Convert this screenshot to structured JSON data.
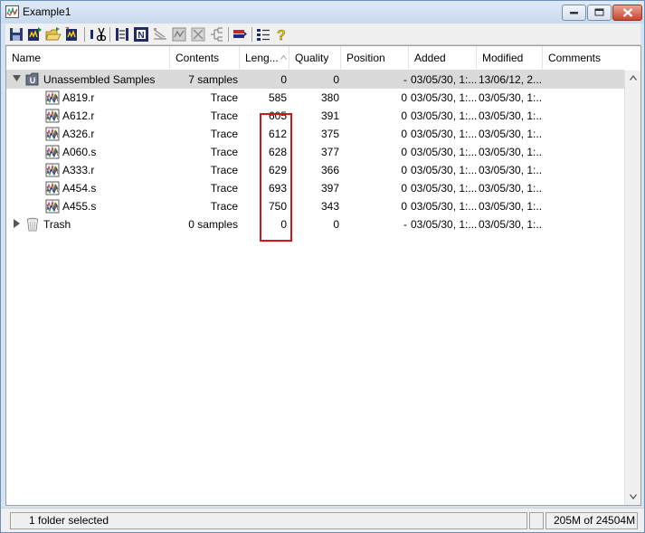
{
  "window": {
    "title": "Example1"
  },
  "toolbar": {
    "buttons": [
      {
        "icon": "save-icon"
      },
      {
        "icon": "import-icon"
      },
      {
        "icon": "open-folder-icon"
      },
      {
        "icon": "export-icon"
      },
      {
        "icon": "cut-icon"
      },
      {
        "icon": "align-icon"
      },
      {
        "icon": "n-sequence-icon"
      },
      {
        "icon": "ladder-icon"
      },
      {
        "icon": "grid-icon"
      },
      {
        "icon": "disabled-x-icon"
      },
      {
        "icon": "tree-icon"
      },
      {
        "icon": "flag-icon"
      },
      {
        "icon": "list-icon"
      },
      {
        "icon": "help-icon"
      }
    ]
  },
  "columns": {
    "name": "Name",
    "contents": "Contents",
    "length": "Leng...",
    "quality": "Quality",
    "position": "Position",
    "added": "Added",
    "modified": "Modified",
    "comments": "Comments"
  },
  "rows": [
    {
      "name": "Unassembled Samples",
      "contents": "7 samples",
      "length": "0",
      "quality": "0",
      "position": "-",
      "added": "03/05/30, 1:...",
      "modified": "13/06/12, 2...",
      "comments": ""
    },
    {
      "name": "A819.r",
      "contents": "Trace",
      "length": "585",
      "quality": "380",
      "position": "0",
      "added": "03/05/30, 1:...",
      "modified": "03/05/30, 1:...",
      "comments": ""
    },
    {
      "name": "A612.r",
      "contents": "Trace",
      "length": "605",
      "quality": "391",
      "position": "0",
      "added": "03/05/30, 1:...",
      "modified": "03/05/30, 1:...",
      "comments": ""
    },
    {
      "name": "A326.r",
      "contents": "Trace",
      "length": "612",
      "quality": "375",
      "position": "0",
      "added": "03/05/30, 1:...",
      "modified": "03/05/30, 1:...",
      "comments": ""
    },
    {
      "name": "A060.s",
      "contents": "Trace",
      "length": "628",
      "quality": "377",
      "position": "0",
      "added": "03/05/30, 1:...",
      "modified": "03/05/30, 1:...",
      "comments": ""
    },
    {
      "name": "A333.r",
      "contents": "Trace",
      "length": "629",
      "quality": "366",
      "position": "0",
      "added": "03/05/30, 1:...",
      "modified": "03/05/30, 1:...",
      "comments": ""
    },
    {
      "name": "A454.s",
      "contents": "Trace",
      "length": "693",
      "quality": "397",
      "position": "0",
      "added": "03/05/30, 1:...",
      "modified": "03/05/30, 1:...",
      "comments": ""
    },
    {
      "name": "A455.s",
      "contents": "Trace",
      "length": "750",
      "quality": "343",
      "position": "0",
      "added": "03/05/30, 1:...",
      "modified": "03/05/30, 1:...",
      "comments": ""
    },
    {
      "name": "Trash",
      "contents": "0 samples",
      "length": "0",
      "quality": "0",
      "position": "-",
      "added": "03/05/30, 1:...",
      "modified": "03/05/30, 1:...",
      "comments": ""
    }
  ],
  "status": {
    "selection": "1 folder selected",
    "memory": "205M of 24504M"
  },
  "colors": {
    "selection_row": "#dadada",
    "highlight_box": "#d01818"
  }
}
